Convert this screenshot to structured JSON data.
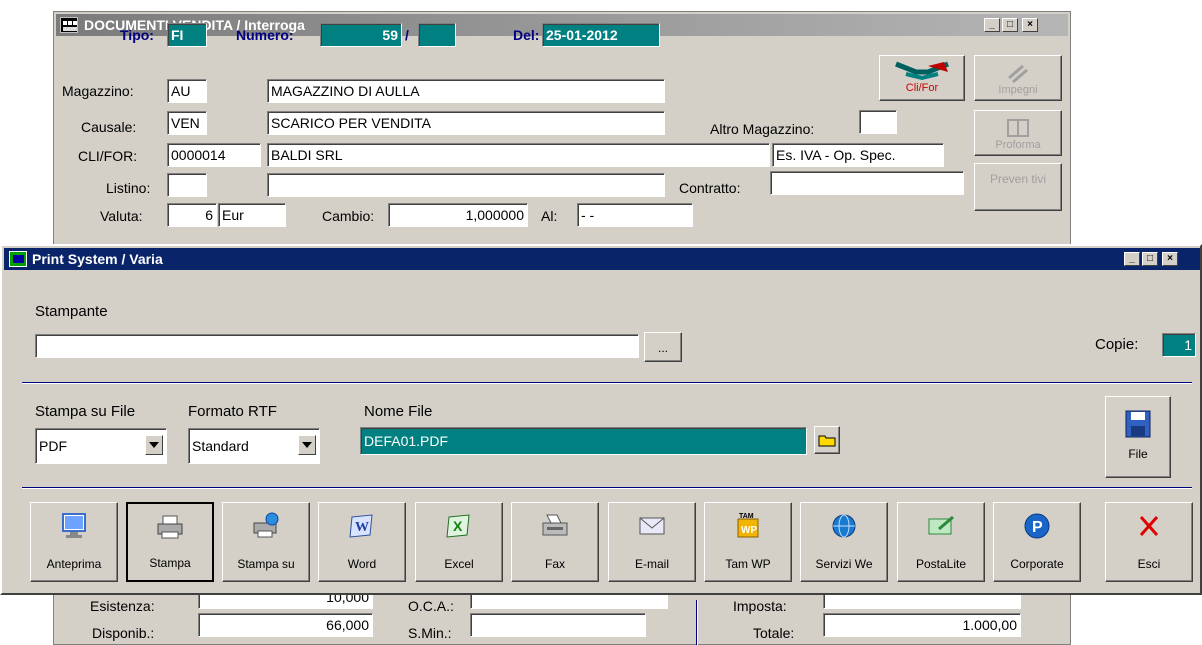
{
  "back_window": {
    "title": "DOCUMENTI VENDITA / Interroga",
    "header": {
      "tipo_label": "Tipo:",
      "tipo_value": "FI",
      "numero_label": "Numero:",
      "numero_value": "59",
      "numero_sep": "/",
      "numero_suffix": "",
      "del_label": "Del:",
      "del_value": "25-01-2012"
    },
    "magazzino": {
      "label": "Magazzino:",
      "code": "AU",
      "desc": "MAGAZZINO DI AULLA"
    },
    "causale": {
      "label": "Causale:",
      "code": "VEN",
      "desc": "SCARICO PER VENDITA"
    },
    "altro_magazzino": {
      "label": "Altro Magazzino:",
      "value": ""
    },
    "cli_for": {
      "label": "CLI/FOR:",
      "code": "0000014",
      "desc": "BALDI SRL",
      "iva": "Es. IVA - Op. Spec."
    },
    "listino": {
      "label": "Listino:",
      "code": "",
      "desc": ""
    },
    "contratto": {
      "label": "Contratto:",
      "value": ""
    },
    "valuta": {
      "label": "Valuta:",
      "code": "6",
      "desc": "Eur"
    },
    "cambio": {
      "label": "Cambio:",
      "value": "1,000000",
      "al_label": "Al:",
      "al_value": "- -"
    },
    "side_buttons": {
      "clifor": "Cli/For",
      "impegni": "Impegni",
      "proforma": "Proforma",
      "preventivi": "Preven tivi"
    },
    "bottom": {
      "esistenza_label": "Esistenza:",
      "esistenza_value": "10,000",
      "oca_label": "O.C.A.:",
      "oca_value": "",
      "disponib_label": "Disponib.:",
      "disponib_value": "66,000",
      "smin_label": "S.Min.:",
      "smin_value": "",
      "imposta_label": "Imposta:",
      "imposta_value": "",
      "totale_label": "Totale:",
      "totale_value": "1.000,00"
    }
  },
  "print_window": {
    "title": "Print System / Varia",
    "stampante_label": "Stampante",
    "stampante_value": "",
    "browse_label": "...",
    "copie_label": "Copie:",
    "copie_value": "1",
    "stampa_su_file_label": "Stampa su File",
    "stampa_su_file_value": "PDF",
    "formato_rtf_label": "Formato RTF",
    "formato_rtf_value": "Standard",
    "nome_file_label": "Nome File",
    "nome_file_value": "DEFA01.PDF",
    "file_button": "File",
    "toolbar": [
      {
        "label": "Anteprima"
      },
      {
        "label": "Stampa"
      },
      {
        "label": "Stampa su"
      },
      {
        "label": "Word"
      },
      {
        "label": "Excel"
      },
      {
        "label": "Fax"
      },
      {
        "label": "E-mail"
      },
      {
        "label": "Tam WP"
      },
      {
        "label": "Servizi We"
      },
      {
        "label": "PostaLite"
      },
      {
        "label": "Corporate"
      }
    ],
    "exit_label": "Esci",
    "colors": {
      "title_active": "#0a246a",
      "teal": "#008080",
      "navy_label": "#000080"
    }
  }
}
